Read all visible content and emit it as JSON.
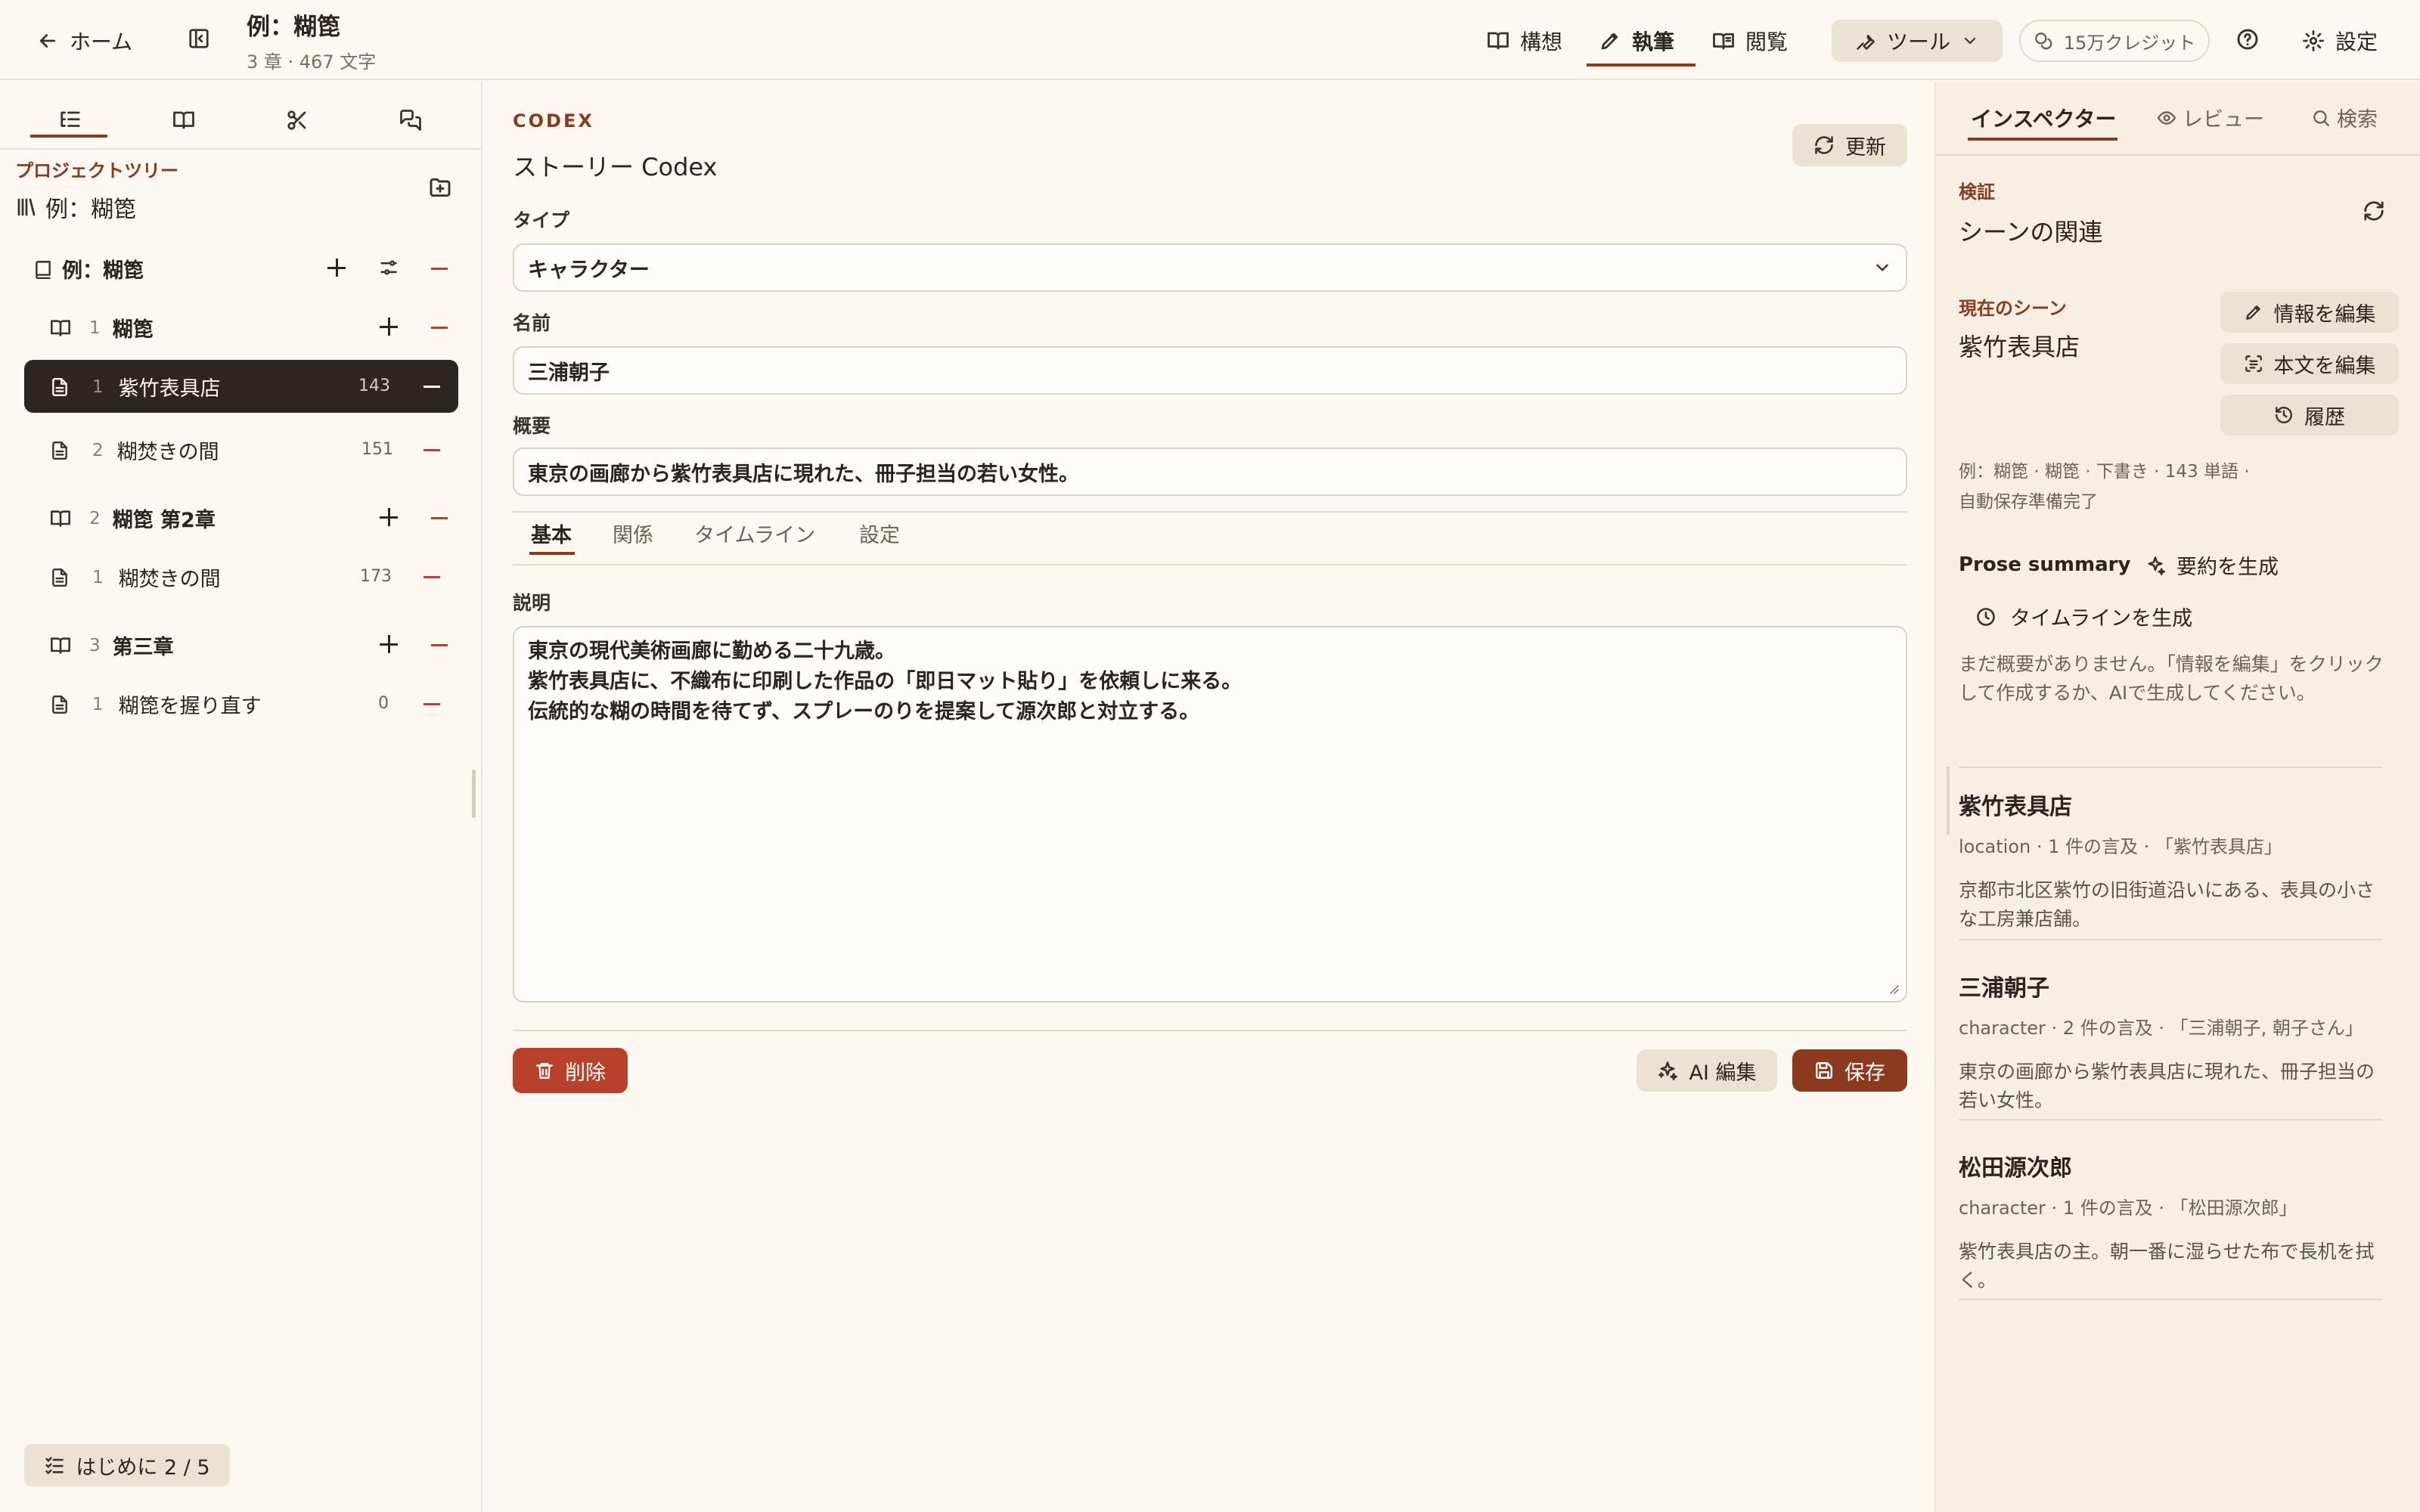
{
  "header": {
    "home": "ホーム",
    "project_title": "例：糊箆",
    "project_meta": "3 章 · 467 文字",
    "modes": [
      "構想",
      "執筆",
      "閲覧"
    ],
    "tools": "ツール",
    "credits": "15万クレジット",
    "settings": "設定"
  },
  "left": {
    "tree_label": "プロジェクトツリー",
    "project_name": "例：糊箆",
    "book": "例：糊箆",
    "chapters": [
      {
        "num": "1",
        "title": "糊箆",
        "scenes": [
          {
            "num": "1",
            "title": "紫竹表具店",
            "count": "143"
          },
          {
            "num": "2",
            "title": "糊焚きの間",
            "count": "151"
          }
        ]
      },
      {
        "num": "2",
        "title": "糊箆 第2章",
        "scenes": [
          {
            "num": "1",
            "title": "糊焚きの間",
            "count": "173"
          }
        ]
      },
      {
        "num": "3",
        "title": "第三章",
        "scenes": [
          {
            "num": "1",
            "title": "糊箆を握り直す",
            "count": "0"
          }
        ]
      }
    ],
    "onboarding": "はじめに 2 / 5"
  },
  "main": {
    "eyebrow": "CODEX",
    "title": "ストーリー Codex",
    "refresh": "更新",
    "type_label": "タイプ",
    "type_value": "キャラクター",
    "name_label": "名前",
    "name_value": "三浦朝子",
    "summary_label": "概要",
    "summary_value": "東京の画廊から紫竹表具店に現れた、冊子担当の若い女性。",
    "tabs": [
      "基本",
      "関係",
      "タイムライン",
      "設定"
    ],
    "desc_label": "説明",
    "desc_lines": [
      "東京の現代美術画廊に勤める二十九歳。",
      "紫竹表具店に、不織布に印刷した作品の「即日マット貼り」を依頼しに来る。",
      "伝統的な糊の時間を待てず、スプレーのりを提案して源次郎と対立する。"
    ],
    "delete": "削除",
    "ai_edit": "AI 編集",
    "save": "保存"
  },
  "right": {
    "tabs": [
      "インスペクター",
      "レビュー",
      "検索"
    ],
    "verify_label": "検証",
    "verify_title": "シーンの関連",
    "current_label": "現在のシーン",
    "current_scene": "紫竹表具店",
    "edit_info": "情報を編集",
    "edit_text": "本文を編集",
    "history": "履歴",
    "meta_line": "例：糊箆 · 糊箆 · 下書き · 143 単語 ·",
    "autosave": "自動保存準備完了",
    "prose_summary": "Prose summary",
    "gen_summary": "要約を生成",
    "gen_timeline": "タイムラインを生成",
    "empty_summary": "まだ概要がありません。「情報を編集」をクリックして作成するか、AIで生成してください。",
    "entries": [
      {
        "title": "紫竹表具店",
        "meta": "location · 1 件の言及 · 「紫竹表具店」",
        "desc": "京都市北区紫竹の旧街道沿いにある、表具の小さな工房兼店舗。"
      },
      {
        "title": "三浦朝子",
        "meta": "character · 2 件の言及 · 「三浦朝子, 朝子さん」",
        "desc": "東京の画廊から紫竹表具店に現れた、冊子担当の若い女性。"
      },
      {
        "title": "松田源次郎",
        "meta": "character · 1 件の言及 · 「松田源次郎」",
        "desc": "紫竹表具店の主。朝一番に湿らせた布で長机を拭く。"
      }
    ]
  },
  "colors": {
    "accent": "#8b3a1e",
    "danger": "#b8412b",
    "selected_row": "#2e2520",
    "save": "#8b3a1e"
  }
}
